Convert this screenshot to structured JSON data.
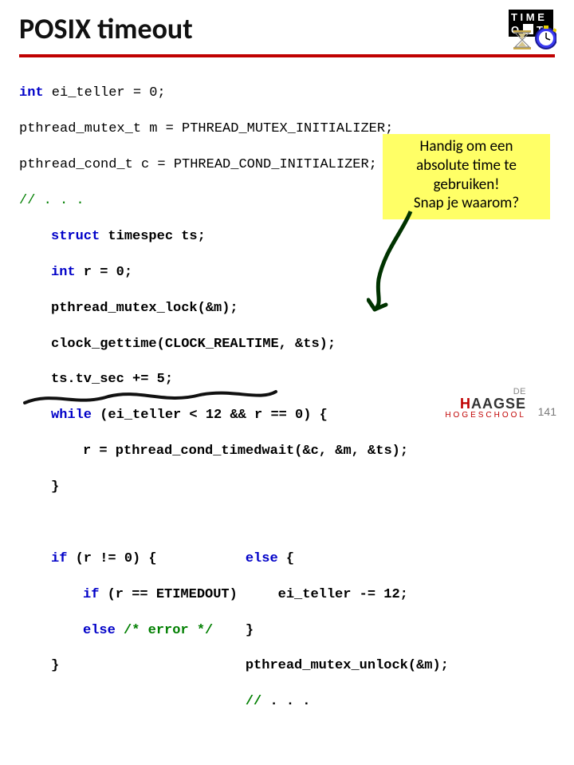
{
  "slide": {
    "title": "POSIX timeout",
    "page_number": "141"
  },
  "code": {
    "l1a": "int",
    "l1b": " ei_teller = 0;",
    "l2": "pthread_mutex_t m = PTHREAD_MUTEX_INITIALIZER;",
    "l3": "pthread_cond_t c = PTHREAD_COND_INITIALIZER;",
    "l4": "// . . .",
    "l5a": "struct",
    "l5b": " timespec ts;",
    "l6a": "int",
    "l6b": " r = 0;",
    "l7": "pthread_mutex_lock(&m);",
    "l8": "clock_gettime(CLOCK_REALTIME, &ts);",
    "l9": "ts.tv_sec += 5;",
    "l10a": "while",
    "l10b": " (ei_teller < 12 && r == 0) {",
    "l11": "r = pthread_cond_timedwait(&c, &m, &ts);",
    "l12": "}",
    "l13a": "if",
    "l13b": " (r != 0) {",
    "l14a": "if",
    "l14b": " (r == ETIMEDOUT)",
    "l15a": "else",
    "l15b": " /* error */",
    "l16": "}",
    "r1a": "else",
    "r1b": " {",
    "r2": "    ei_teller -= 12;",
    "r3": "}",
    "r4": "pthread_mutex_unlock(&m);",
    "r5a": "//",
    "r5b": " . . ."
  },
  "callout": {
    "line1": "Handig om een",
    "line2": "absolute time te",
    "line3": "gebruiken!",
    "line4": "Snap je waarom?"
  },
  "logo": {
    "prefix": "DE",
    "main1": "H",
    "main2": "AAGSE",
    "sub": "HOGESCHOOL"
  }
}
